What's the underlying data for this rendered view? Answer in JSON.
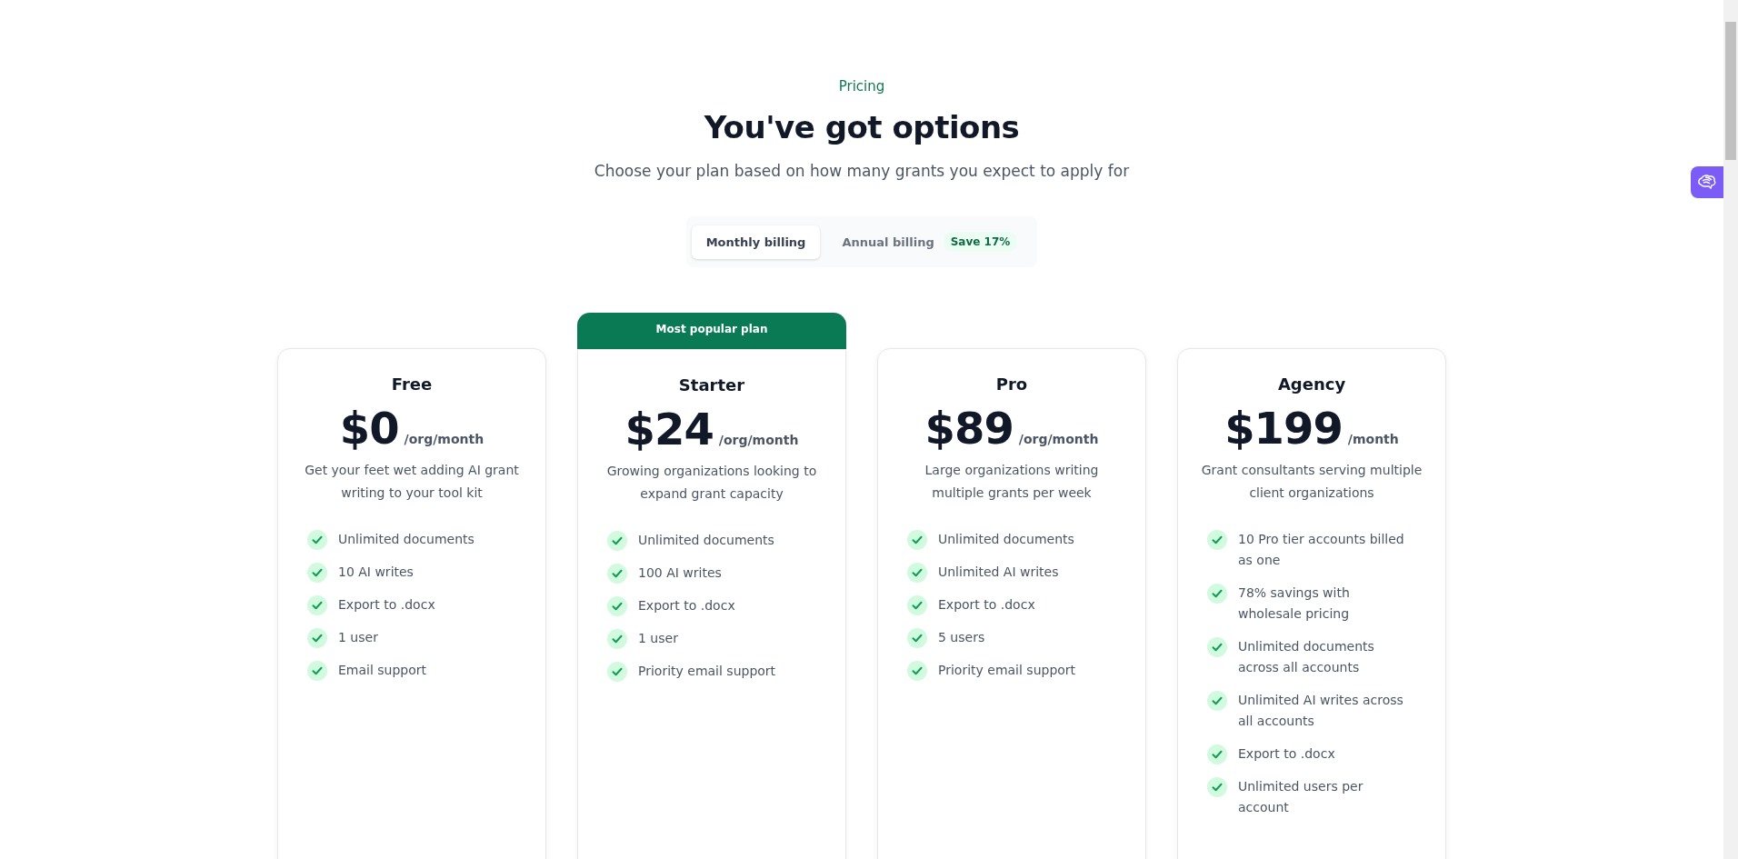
{
  "header": {
    "eyebrow": "Pricing",
    "title": "You've got options",
    "subtitle": "Choose your plan based on how many grants you expect to apply for"
  },
  "billing_toggle": {
    "options": [
      {
        "label": "Monthly billing",
        "selected": true
      },
      {
        "label": "Annual billing",
        "selected": false,
        "badge": "Save 17%"
      }
    ]
  },
  "plans": [
    {
      "name": "Free",
      "price": "$0",
      "period": "/org/month",
      "description": "Get your feet wet adding AI grant writing to your tool kit",
      "features": [
        "Unlimited documents",
        "10 AI writes",
        "Export to .docx",
        "1 user",
        "Email support"
      ]
    },
    {
      "name": "Starter",
      "banner": "Most popular plan",
      "price": "$24",
      "period": "/org/month",
      "description": "Growing organizations looking to expand grant capacity",
      "features": [
        "Unlimited documents",
        "100 AI writes",
        "Export to .docx",
        "1 user",
        "Priority email support"
      ]
    },
    {
      "name": "Pro",
      "price": "$89",
      "period": "/org/month",
      "description": "Large organizations writing multiple grants per week",
      "features": [
        "Unlimited documents",
        "Unlimited AI writes",
        "Export to .docx",
        "5 users",
        "Priority email support"
      ]
    },
    {
      "name": "Agency",
      "price": "$199",
      "period": "/month",
      "description": "Grant consultants serving multiple client organizations",
      "features": [
        "10 Pro tier accounts billed as one",
        "78% savings with wholesale pricing",
        "Unlimited documents across all accounts",
        "Unlimited AI writes across all accounts",
        "Export to .docx",
        "Unlimited users per account"
      ]
    }
  ]
}
